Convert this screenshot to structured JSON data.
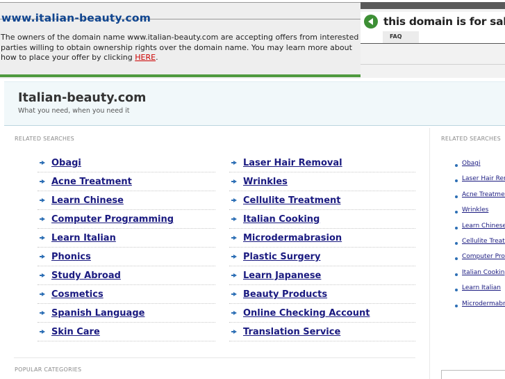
{
  "banner": {
    "domain": "www.italian-beauty.com",
    "text_before": "The owners of the domain name www.italian-beauty.com are accepting offers from interested parties willing to obtain ownership rights over the domain name. You may learn more about how to place your offer by clicking ",
    "here_link": "HERE",
    "text_after": ".",
    "sale_text": "this domain is for sale",
    "faq_label": "FAQ"
  },
  "site": {
    "title": "Italian-beauty.com",
    "tagline": "What you need, when you need it"
  },
  "related": {
    "label": "RELATED SEARCHES",
    "left": [
      "Obagi",
      "Acne Treatment",
      "Learn Chinese",
      "Computer Programming",
      "Learn Italian",
      "Phonics",
      "Study Abroad",
      "Cosmetics",
      "Spanish Language",
      "Skin Care"
    ],
    "right": [
      "Laser Hair Removal",
      "Wrinkles",
      "Cellulite Treatment",
      "Italian Cooking",
      "Microdermabrasion",
      "Plastic Surgery",
      "Learn Japanese",
      "Beauty Products",
      "Online Checking Account",
      "Translation Service"
    ]
  },
  "popular": {
    "label": "POPULAR CATEGORIES"
  },
  "sidebar": {
    "label": "RELATED SEARCHES",
    "items": [
      "Obagi",
      "Laser Hair Removal",
      "Acne Treatment",
      "Wrinkles",
      "Learn Chinese",
      "Cellulite Treatment",
      "Computer Programming",
      "Italian Cooking",
      "Learn Italian",
      "Microdermabrasion"
    ]
  },
  "colors": {
    "accent_green": "#4f9a3e",
    "link": "#1a1a80",
    "domain_blue": "#10458f"
  }
}
